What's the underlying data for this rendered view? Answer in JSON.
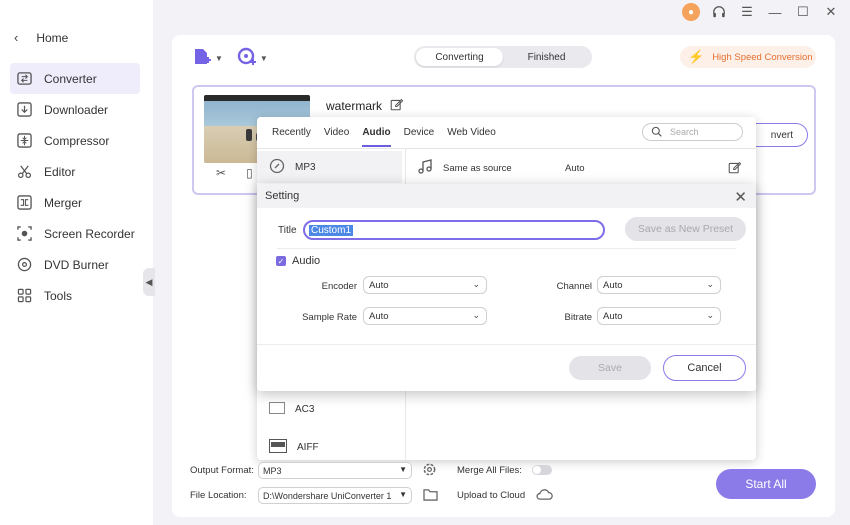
{
  "sidebar": {
    "home": "Home",
    "items": [
      {
        "label": "Converter",
        "icon": "converter-icon"
      },
      {
        "label": "Downloader",
        "icon": "download-icon"
      },
      {
        "label": "Compressor",
        "icon": "compress-icon"
      },
      {
        "label": "Editor",
        "icon": "scissors-icon"
      },
      {
        "label": "Merger",
        "icon": "merge-icon"
      },
      {
        "label": "Screen Recorder",
        "icon": "record-icon"
      },
      {
        "label": "DVD Burner",
        "icon": "disc-icon"
      },
      {
        "label": "Tools",
        "icon": "grid-icon"
      }
    ]
  },
  "header": {
    "seg": {
      "converting": "Converting",
      "finished": "Finished"
    },
    "high_speed": "High Speed Conversion"
  },
  "file": {
    "name": "watermark",
    "convert_label": "nvert"
  },
  "format_panel": {
    "tabs": [
      "Recently",
      "Video",
      "Audio",
      "Device",
      "Web Video"
    ],
    "active_tab": "Audio",
    "search_placeholder": "Search",
    "items": [
      "MP3",
      "AC3",
      "AIFF"
    ],
    "row": {
      "format": "Same as source",
      "quality": "Auto"
    }
  },
  "dialog": {
    "title": "Setting",
    "title_label": "Title",
    "title_value": "Custom1",
    "save_preset": "Save as New Preset",
    "audio_label": "Audio",
    "encoder_label": "Encoder",
    "encoder_value": "Auto",
    "channel_label": "Channel",
    "channel_value": "Auto",
    "sample_rate_label": "Sample Rate",
    "sample_rate_value": "Auto",
    "bitrate_label": "Bitrate",
    "bitrate_value": "Auto",
    "save": "Save",
    "cancel": "Cancel"
  },
  "bottom": {
    "output_format_label": "Output Format:",
    "output_format_value": "MP3",
    "merge_label": "Merge All Files:",
    "file_location_label": "File Location:",
    "file_location_value": "D:\\Wondershare UniConverter 1",
    "upload_label": "Upload to Cloud",
    "start_all": "Start All"
  }
}
